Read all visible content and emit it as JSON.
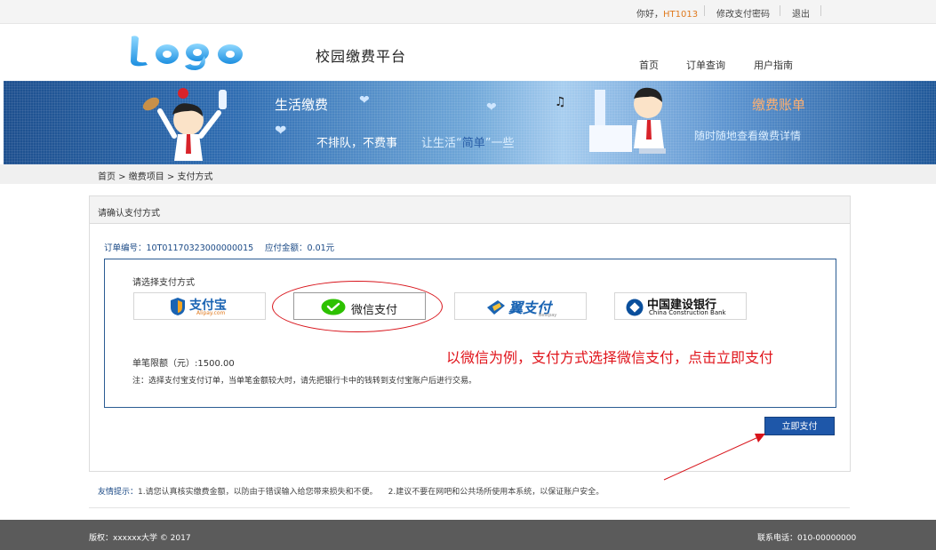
{
  "topbar": {
    "greeting_prefix": "你好，",
    "username": "HT1013",
    "change_pwd": "修改支付密码",
    "logout": "退出"
  },
  "header": {
    "logo_text": "Logo",
    "site_title": "校园缴费平台"
  },
  "nav": {
    "home": "首页",
    "order_query": "订单查询",
    "user_guide": "用户指南"
  },
  "banner": {
    "life_pay": "生活缴费",
    "no_queue": "不排队，不费事",
    "slogan_a": "让生活“",
    "slogan_b": "简单",
    "slogan_c": "”一些",
    "bill_title": "缴费账单",
    "bill_sub": "随时随地查看缴费详情"
  },
  "breadcrumb": "首页 > 缴费项目 > 支付方式",
  "panel": {
    "title": "请确认支付方式",
    "order_no_label": "订单编号：",
    "order_no": "10T01170323000000015",
    "amount_label": "应付金额：",
    "amount": "0.01元",
    "choose_label": "请选择支付方式",
    "methods": [
      {
        "label": "支付宝",
        "sub": "Alipay.com",
        "icon": "alipay-icon"
      },
      {
        "label": "微信支付",
        "icon": "wechat-icon"
      },
      {
        "label": "翼支付",
        "sub": "Bestpay",
        "icon": "bestpay-icon"
      },
      {
        "label": "中国建设银行",
        "sub": "China Construction Bank",
        "icon": "ccb-icon"
      }
    ],
    "limit": "单笔限额（元）:1500.00",
    "note": "注：选择支付宝支付订单，当单笔金额较大时，请先把银行卡中的钱转到支付宝账户后进行交易。",
    "pay_now": "立即支付"
  },
  "annotation": "以微信为例，支付方式选择微信支付，点击立即支付",
  "tips": {
    "label": "友情提示：",
    "tip1": "1.请您认真核实缴费金额，以防由于错误输入给您带来损失和不便。",
    "tip2": "2.建议不要在网吧和公共场所使用本系统，以保证账户安全。"
  },
  "footer": {
    "copyright": "版权：xxxxxx大学 © 2017",
    "phone": "联系电话：010-00000000"
  },
  "colors": {
    "accent": "#1e57a9",
    "annotation": "#e0141b",
    "banner": "#2f6db2",
    "wechat": "#2dc100",
    "ccb": "#0a4f9c"
  }
}
